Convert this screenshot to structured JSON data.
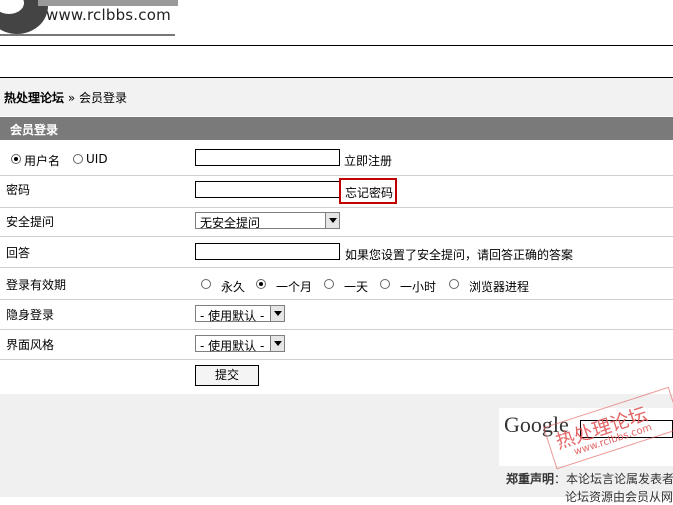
{
  "header": {
    "logo_url": "www.rclbbs.com"
  },
  "breadcrumb": {
    "home": "热处理论坛",
    "sep": " » ",
    "current": "会员登录"
  },
  "panel": {
    "title": "会员登录"
  },
  "form": {
    "username_radio": "用户名",
    "uid_radio": "UID",
    "register_link": "立即注册",
    "password_label": "密码",
    "forgot_link": "忘记密码",
    "security_label": "安全提问",
    "security_select": "无安全提问",
    "answer_label": "回答",
    "answer_hint": "如果您设置了安全提问，请回答正确的答案",
    "expiry_label": "登录有效期",
    "expiry_options": [
      "永久",
      "一个月",
      "一天",
      "一小时",
      "浏览器进程"
    ],
    "expiry_selected": "一个月",
    "stealth_label": "隐身登录",
    "stealth_select": "- 使用默认 -",
    "style_label": "界面风格",
    "style_select": "- 使用默认 -",
    "submit_label": "提交"
  },
  "footer": {
    "google": "Google",
    "notice_bold": "郑重声明",
    "notice_rest": "：本论坛言论属发表者",
    "notice_line2": "论坛资源由会员从网"
  },
  "watermark": {
    "title": "热处理论坛",
    "url": "www.rclbbs.com"
  },
  "colors": {
    "panel_header": "#7a7a7a",
    "highlight_box": "#c00000",
    "watermark": "#e25656"
  }
}
